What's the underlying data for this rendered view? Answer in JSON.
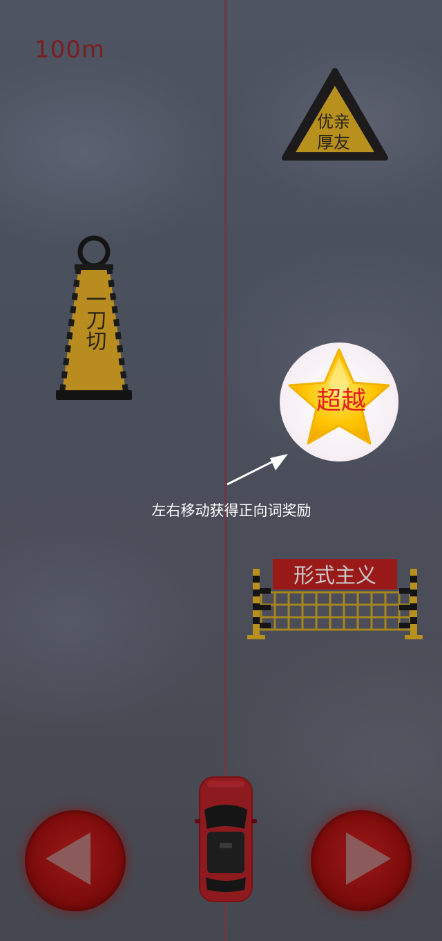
{
  "hud": {
    "distance": "100m"
  },
  "obstacles": {
    "triangle_sign": {
      "line1": "优亲",
      "line2": "厚友"
    },
    "traffic_cone": {
      "label": "一刀切"
    },
    "barrier": {
      "label": "形式主义"
    }
  },
  "reward": {
    "star_label": "超越"
  },
  "tutorial": {
    "hint": "左右移动获得正向词奖励"
  },
  "controls": {
    "left_icon": "left-arrow-icon",
    "right_icon": "right-arrow-icon"
  },
  "colors": {
    "button_red": "#8a1010",
    "sign_yellow": "#c9971c",
    "text_red": "#e02020"
  }
}
